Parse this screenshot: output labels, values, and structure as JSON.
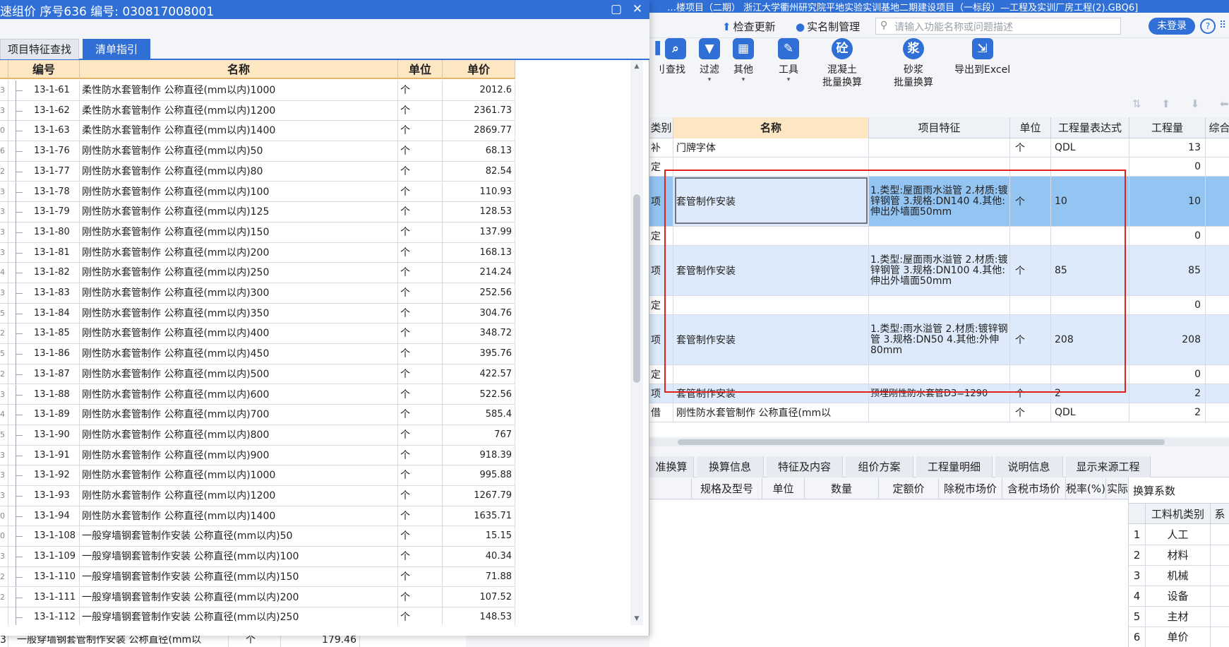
{
  "main_window": {
    "title": "…楼项目（二期）  浙江大学衢州研究院平地实验实训基地二期建设项目（一标段）—工程及实训厂房工程(2).GBQ6]",
    "topbar": {
      "check_update": "检查更新",
      "realname": "实名制管理",
      "search_placeholder": "请输入功能名称或问题描述",
      "login": "未登录",
      "help": "?",
      "more": "⠿"
    },
    "ribbon": {
      "partial": "刂",
      "find": "查找",
      "filter": "过滤",
      "other": "其他",
      "tools": "工具",
      "concrete_line1": "混凝土",
      "concrete_line2": "批量换算",
      "mortar_line1": "砂浆",
      "mortar_line2": "批量换算",
      "export": "导出到Excel",
      "arrow": "▾"
    },
    "nav_arrows": "⇅ ⬆ ⬇ ⬅ ➡",
    "grid": {
      "headers": {
        "type": "类别",
        "name": "名称",
        "feature": "项目特征",
        "unit": "单位",
        "expr": "工程量表达式",
        "qty": "工程量",
        "more": "综合"
      },
      "rows": [
        {
          "type": "补",
          "name": "门牌字体",
          "feature": "",
          "unit": "个",
          "expr": "QDL",
          "qty": "13"
        },
        {
          "type": "定",
          "name": "",
          "feature": "",
          "unit": "",
          "expr": "",
          "qty": "0"
        },
        {
          "type": "项",
          "name": "套管制作安装",
          "feature": "1.类型:屋面雨水溢管\n2.材质:镀锌钢管\n3.规格:DN140\n4.其他:伸出外墙面50mm",
          "unit": "个",
          "expr": "10",
          "qty": "10"
        },
        {
          "type": "定",
          "name": "",
          "feature": "",
          "unit": "",
          "expr": "",
          "qty": "0"
        },
        {
          "type": "项",
          "name": "套管制作安装",
          "feature": "1.类型:屋面雨水溢管\n2.材质:镀锌钢管\n3.规格:DN100\n4.其他:伸出外墙面50mm",
          "unit": "个",
          "expr": "85",
          "qty": "85"
        },
        {
          "type": "定",
          "name": "",
          "feature": "",
          "unit": "",
          "expr": "",
          "qty": "0"
        },
        {
          "type": "项",
          "name": "套管制作安装",
          "feature": "1.类型:雨水溢管\n2.材质:镀锌钢管\n3.规格:DN50\n4.其他:外伸80mm",
          "unit": "个",
          "expr": "208",
          "qty": "208"
        },
        {
          "type": "定",
          "name": "",
          "feature": "",
          "unit": "",
          "expr": "",
          "qty": "0"
        },
        {
          "type": "项",
          "name": "套管制作安装",
          "feature": "预埋刚性防水套管D3=1290",
          "unit": "个",
          "expr": "2",
          "qty": "2"
        },
        {
          "type": "借",
          "name": "刚性防水套管制作 公称直径(mm以",
          "feature": "",
          "unit": "个",
          "expr": "QDL",
          "qty": "2"
        }
      ]
    },
    "bottom_tabs": [
      "准换算",
      "换算信息",
      "特征及内容",
      "组价方案",
      "工程量明细",
      "说明信息",
      "显示来源工程"
    ],
    "bottom_cols": [
      "规格及型号",
      "单位",
      "数量",
      "定额价",
      "除税市场价",
      "含税市场价",
      "税率(%)",
      "实际"
    ],
    "coef_panel": {
      "title": "换算系数",
      "header": "工料机类别",
      "header2": "系",
      "rows": [
        {
          "no": "1",
          "name": "人工"
        },
        {
          "no": "2",
          "name": "材料"
        },
        {
          "no": "3",
          "name": "机械"
        },
        {
          "no": "4",
          "name": "设备"
        },
        {
          "no": "5",
          "name": "主材"
        },
        {
          "no": "6",
          "name": "单价"
        }
      ]
    }
  },
  "dialog": {
    "title": "速组价 序号636 编号: 030817008001",
    "maximize": "▢",
    "close": "✕",
    "tabs": {
      "feature_search": "项目特征查找",
      "list_guide": "清单指引"
    },
    "headers": {
      "code": "编号",
      "name": "名称",
      "unit": "单位",
      "price": "单价"
    },
    "rows": [
      {
        "g": "3",
        "code": "13-1-61",
        "name": "柔性防水套管制作 公称直径(mm以内)1000",
        "unit": "个",
        "price": "2012.6"
      },
      {
        "g": "3",
        "code": "13-1-62",
        "name": "柔性防水套管制作 公称直径(mm以内)1200",
        "unit": "个",
        "price": "2361.73"
      },
      {
        "g": "0",
        "code": "13-1-63",
        "name": "柔性防水套管制作 公称直径(mm以内)1400",
        "unit": "个",
        "price": "2869.77"
      },
      {
        "g": "6",
        "code": "13-1-76",
        "name": "刚性防水套管制作 公称直径(mm以内)50",
        "unit": "个",
        "price": "68.13"
      },
      {
        "g": "2",
        "code": "13-1-77",
        "name": "刚性防水套管制作 公称直径(mm以内)80",
        "unit": "个",
        "price": "82.54"
      },
      {
        "g": "3",
        "code": "13-1-78",
        "name": "刚性防水套管制作 公称直径(mm以内)100",
        "unit": "个",
        "price": "110.93"
      },
      {
        "g": "3",
        "code": "13-1-79",
        "name": "刚性防水套管制作 公称直径(mm以内)125",
        "unit": "个",
        "price": "128.53"
      },
      {
        "g": "3",
        "code": "13-1-80",
        "name": "刚性防水套管制作 公称直径(mm以内)150",
        "unit": "个",
        "price": "137.99"
      },
      {
        "g": "3",
        "code": "13-1-81",
        "name": "刚性防水套管制作 公称直径(mm以内)200",
        "unit": "个",
        "price": "168.13"
      },
      {
        "g": "4",
        "code": "13-1-82",
        "name": "刚性防水套管制作 公称直径(mm以内)250",
        "unit": "个",
        "price": "214.24"
      },
      {
        "g": "3",
        "code": "13-1-83",
        "name": "刚性防水套管制作 公称直径(mm以内)300",
        "unit": "个",
        "price": "252.56"
      },
      {
        "g": "5",
        "code": "13-1-84",
        "name": "刚性防水套管制作 公称直径(mm以内)350",
        "unit": "个",
        "price": "304.76"
      },
      {
        "g": "2",
        "code": "13-1-85",
        "name": "刚性防水套管制作 公称直径(mm以内)400",
        "unit": "个",
        "price": "348.72"
      },
      {
        "g": "5",
        "code": "13-1-86",
        "name": "刚性防水套管制作 公称直径(mm以内)450",
        "unit": "个",
        "price": "395.76"
      },
      {
        "g": "2",
        "code": "13-1-87",
        "name": "刚性防水套管制作 公称直径(mm以内)500",
        "unit": "个",
        "price": "422.57"
      },
      {
        "g": "3",
        "code": "13-1-88",
        "name": "刚性防水套管制作 公称直径(mm以内)600",
        "unit": "个",
        "price": "522.56"
      },
      {
        "g": "4",
        "code": "13-1-89",
        "name": "刚性防水套管制作 公称直径(mm以内)700",
        "unit": "个",
        "price": "585.4"
      },
      {
        "g": "5",
        "code": "13-1-90",
        "name": "刚性防水套管制作 公称直径(mm以内)800",
        "unit": "个",
        "price": "767"
      },
      {
        "g": "3",
        "code": "13-1-91",
        "name": "刚性防水套管制作 公称直径(mm以内)900",
        "unit": "个",
        "price": "918.39"
      },
      {
        "g": "3",
        "code": "13-1-92",
        "name": "刚性防水套管制作 公称直径(mm以内)1000",
        "unit": "个",
        "price": "995.88"
      },
      {
        "g": "3",
        "code": "13-1-93",
        "name": "刚性防水套管制作 公称直径(mm以内)1200",
        "unit": "个",
        "price": "1267.79"
      },
      {
        "g": "0",
        "code": "13-1-94",
        "name": "刚性防水套管制作 公称直径(mm以内)1400",
        "unit": "个",
        "price": "1635.71"
      },
      {
        "g": "0",
        "code": "13-1-108",
        "name": "一般穿墙钢套管制作安装 公称直径(mm以内)50",
        "unit": "个",
        "price": "15.15"
      },
      {
        "g": "3",
        "code": "13-1-109",
        "name": "一般穿墙钢套管制作安装 公称直径(mm以内)100",
        "unit": "个",
        "price": "40.34"
      },
      {
        "g": "2",
        "code": "13-1-110",
        "name": "一般穿墙钢套管制作安装 公称直径(mm以内)150",
        "unit": "个",
        "price": "71.88"
      },
      {
        "g": "2",
        "code": "13-1-111",
        "name": "一般穿墙钢套管制作安装 公称直径(mm以内)200",
        "unit": "个",
        "price": "107.52"
      },
      {
        "g": "",
        "code": "13-1-112",
        "name": "一般穿墙钢套管制作安装 公称直径(mm以内)250",
        "unit": "个",
        "price": "148.53"
      }
    ],
    "under_row": {
      "g": "3",
      "name": "一般穿墙钢套管制作安装 公称直径(mm以",
      "unit": "个",
      "price": "179.46"
    }
  },
  "colors": {
    "accent": "#2f6fd6",
    "header_orange": "#fde7c3",
    "selection": "#93c4f2",
    "highlight_box": "#e3211c"
  }
}
